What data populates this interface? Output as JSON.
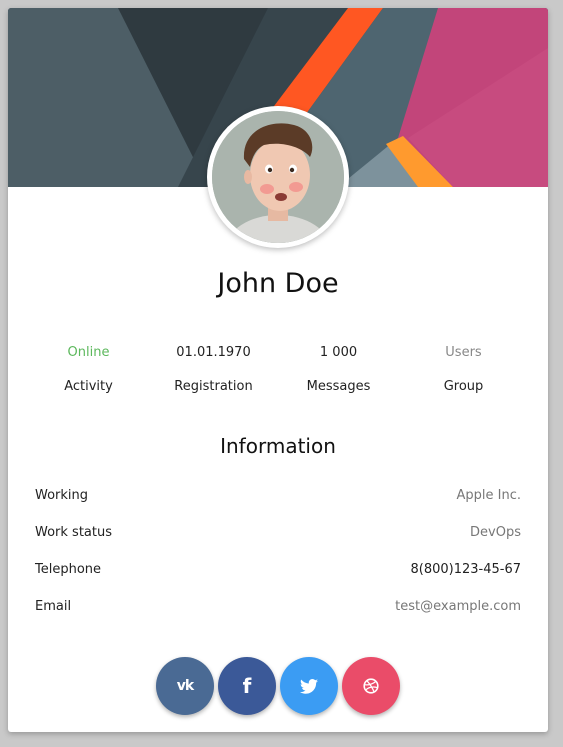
{
  "profile": {
    "name": "John Doe"
  },
  "stats": [
    {
      "value": "Online",
      "label": "Activity",
      "value_color": "#5cb85c"
    },
    {
      "value": "01.01.1970",
      "label": "Registration",
      "value_color": "#222222"
    },
    {
      "value": "1 000",
      "label": "Messages",
      "value_color": "#222222"
    },
    {
      "value": "Users",
      "label": "Group",
      "value_color": "#888888"
    }
  ],
  "information": {
    "title": "Information",
    "rows": [
      {
        "key": "Working",
        "value": "Apple Inc."
      },
      {
        "key": "Work status",
        "value": "DevOps"
      },
      {
        "key": "Telephone",
        "value": "8(800)123-45-67"
      },
      {
        "key": "Email",
        "value": "test@example.com"
      }
    ]
  },
  "social": [
    {
      "icon": "vk-icon",
      "glyph": "vk",
      "color": "#4a6a94"
    },
    {
      "icon": "facebook-icon",
      "glyph": "f",
      "color": "#3b5998"
    },
    {
      "icon": "twitter-icon",
      "glyph": "🐦",
      "color": "#3b9cf3"
    },
    {
      "icon": "dribbble-icon",
      "glyph": "◎",
      "color": "#ea4c69"
    }
  ],
  "colors": {
    "online": "#5cb85c",
    "cover_orange": "#ff5722",
    "cover_pink": "#c2457a",
    "cover_slate": "#465860"
  }
}
